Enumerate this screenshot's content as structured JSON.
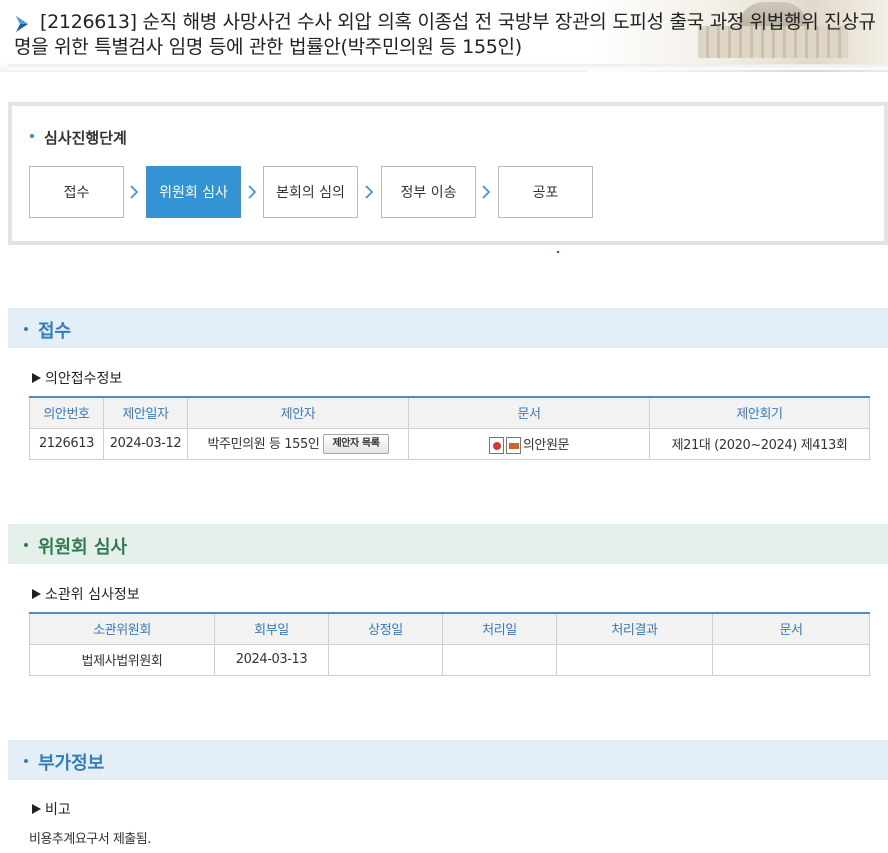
{
  "header": {
    "title": "[2126613] 순직 해병 사망사건 수사 외압 의혹 이종섭 전 국방부 장관의 도피성 출국 과정 위법행위 진상규명을 위한 특별검사 임명 등에 관한 법률안(박주민의원 등 155인)"
  },
  "progress": {
    "title": "심사진행단계",
    "steps": [
      {
        "label": "접수"
      },
      {
        "label": "위원회 심사"
      },
      {
        "label": "본회의 심의"
      },
      {
        "label": "정부 이송"
      },
      {
        "label": "공포"
      }
    ],
    "active_step": "위원회 심사"
  },
  "reception": {
    "section_title": "접수",
    "sub_heading": "의안접수정보",
    "columns": [
      "의안번호",
      "제안일자",
      "제안자",
      "문서",
      "제안회기"
    ],
    "row": {
      "bill_no": "2126613",
      "date": "2024-03-12",
      "proposer": "박주민의원 등 155인",
      "proposer_button": "제안자 목록",
      "document": "의안원문",
      "session": "제21대 (2020~2024) 제413회"
    }
  },
  "committee": {
    "section_title": "위원회 심사",
    "sub_heading": "소관위 심사정보",
    "columns": [
      "소관위원회",
      "회부일",
      "상정일",
      "처리일",
      "처리결과",
      "문서"
    ],
    "row": {
      "committee": "법제사법위원회",
      "referral_date": "2024-03-13",
      "agenda_date": "",
      "process_date": "",
      "result": "",
      "document": ""
    }
  },
  "extra": {
    "section_title": "부가정보",
    "sub_heading": "비고",
    "note": "비용추계요구서 제출됨."
  },
  "colors": {
    "accent_blue": "#3393d3",
    "section_blue_bg": "#e4eef7",
    "section_green_bg": "#e5f0ea",
    "section_green_text": "#2e7d52",
    "table_header_text": "#3b79b8"
  }
}
